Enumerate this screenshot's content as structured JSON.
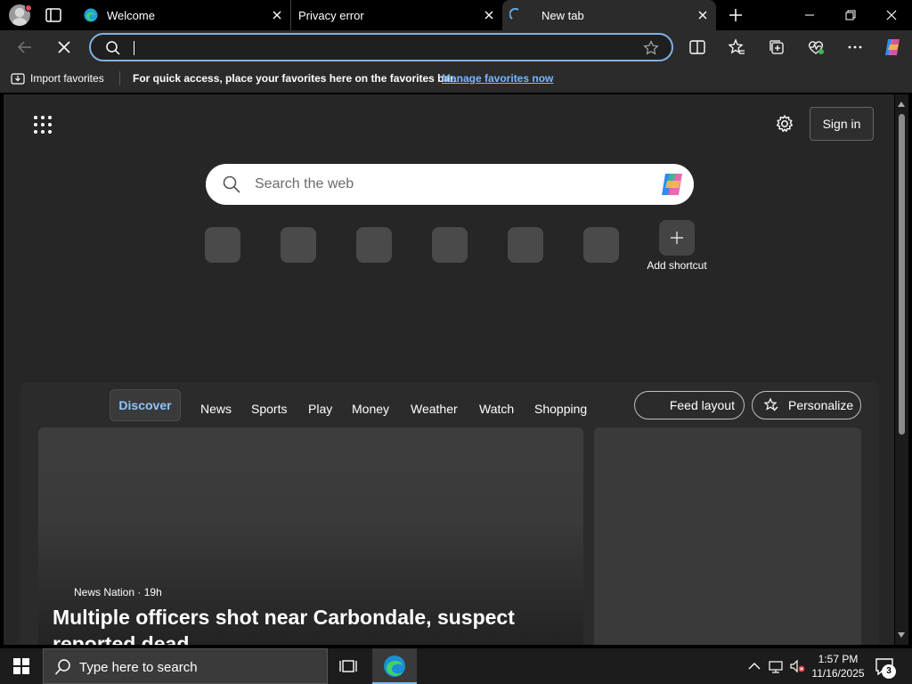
{
  "tabs": [
    {
      "title": "Welcome",
      "state": "open"
    },
    {
      "title": "Privacy error",
      "state": "open"
    },
    {
      "title": "New tab",
      "state": "loading-active"
    }
  ],
  "toolbar": {
    "address_value": ""
  },
  "favorites_bar": {
    "import_label": "Import favorites",
    "message": "For quick access, place your favorites here on the favorites bar.",
    "manage_link": "Manage favorites now"
  },
  "newtab": {
    "sign_in_label": "Sign in",
    "search_placeholder": "Search the web",
    "add_shortcut_label": "Add shortcut",
    "feed_tabs": [
      "Discover",
      "News",
      "Sports",
      "Play",
      "Money",
      "Weather",
      "Watch",
      "Shopping"
    ],
    "active_feed_tab": "Discover",
    "feed_layout_label": "Feed layout",
    "personalize_label": "Personalize",
    "headline_card": {
      "source": "News Nation",
      "age": "19h",
      "title": "Multiple officers shot near Carbondale, suspect reported dead"
    }
  },
  "taskbar": {
    "search_placeholder": "Type here to search",
    "time": "1:57 PM",
    "date": "11/16/2025",
    "notification_count": "3"
  },
  "colors": {
    "accent_link": "#79b8ff",
    "active_tab_text": "#8ec4ff",
    "omnibox_focus": "#7fb0e8"
  }
}
